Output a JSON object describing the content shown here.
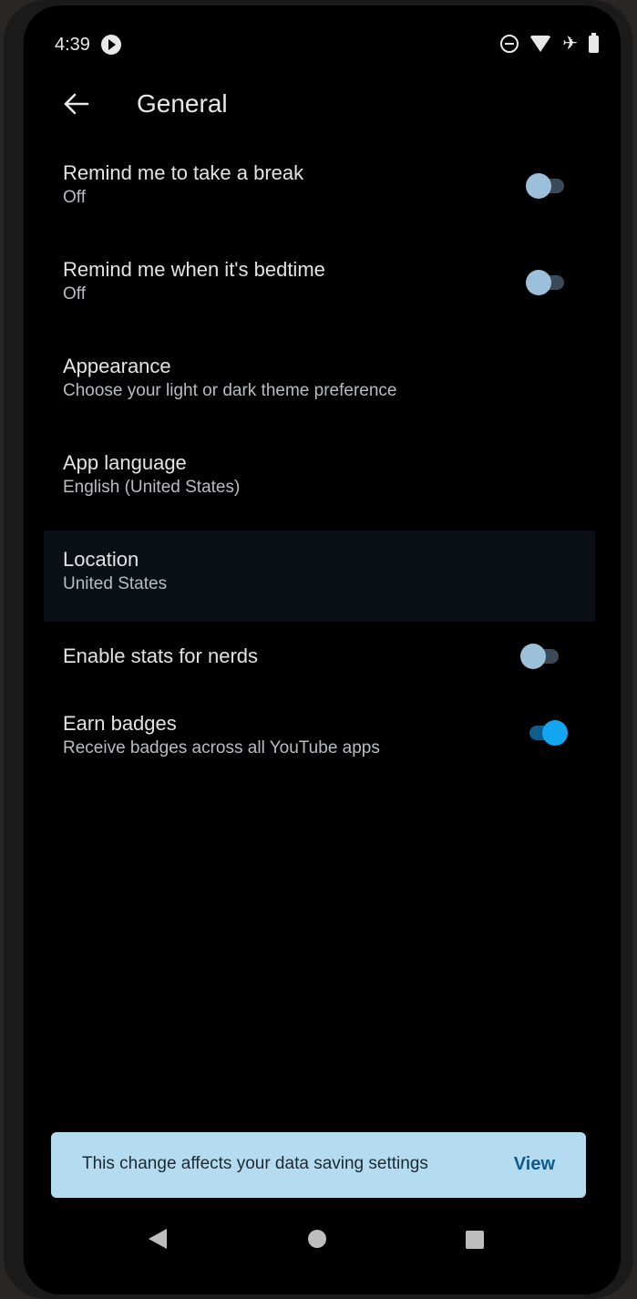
{
  "status_bar": {
    "time": "4:39",
    "icons": [
      "play-notification-icon",
      "do-not-disturb-icon",
      "wifi-icon",
      "airplane-mode-icon",
      "battery-icon"
    ]
  },
  "header": {
    "title": "General",
    "back_icon": "arrow-left-icon"
  },
  "settings": [
    {
      "id": "break",
      "title": "Remind me to take a break",
      "subtitle": "Off",
      "toggle": false
    },
    {
      "id": "bedtime",
      "title": "Remind me when it's bedtime",
      "subtitle": "Off",
      "toggle": false
    },
    {
      "id": "appearance",
      "title": "Appearance",
      "subtitle": "Choose your light or dark theme preference"
    },
    {
      "id": "language",
      "title": "App language",
      "subtitle": "English (United States)"
    },
    {
      "id": "location",
      "title": "Location",
      "subtitle": "United States"
    },
    {
      "id": "stats",
      "title": "Enable stats for nerds",
      "toggle": false
    },
    {
      "id": "badges",
      "title": "Earn badges",
      "subtitle": "Receive badges across all YouTube apps",
      "toggle": true
    }
  ],
  "snackbar": {
    "message": "This change affects your data saving settings",
    "action": "View"
  },
  "colors": {
    "background": "#000000",
    "toggle_on": "#13a6f0",
    "snackbar": "#b5dbf0"
  }
}
